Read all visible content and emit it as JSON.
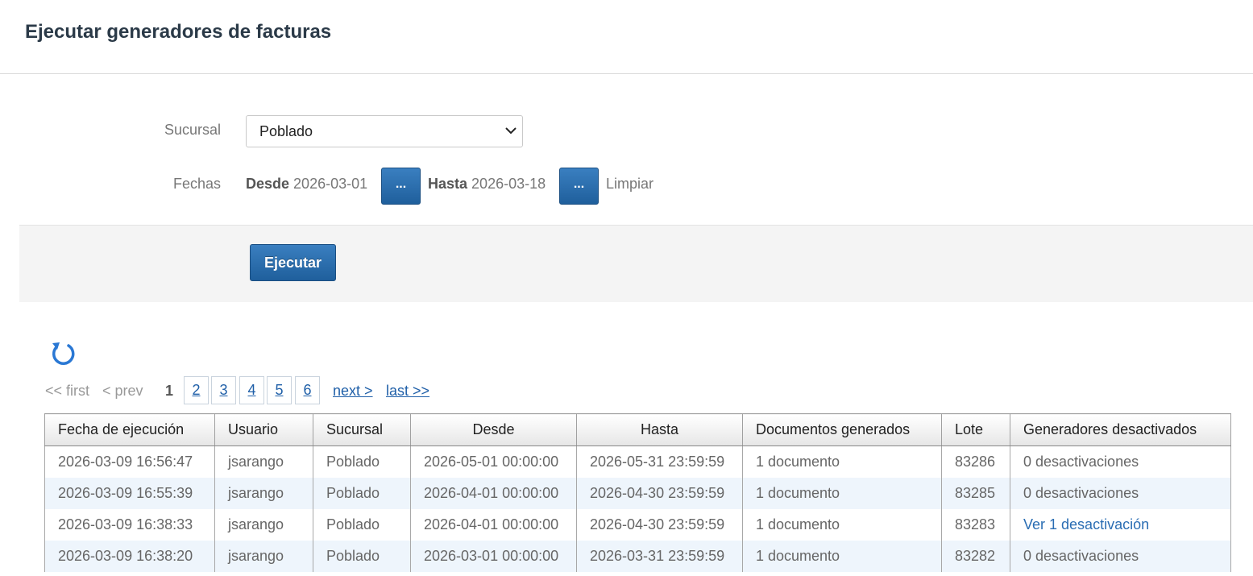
{
  "header": {
    "title": "Ejecutar generadores de facturas"
  },
  "form": {
    "sucursal_label": "Sucursal",
    "sucursal_value": "Poblado",
    "fechas_label": "Fechas",
    "desde_label": "Desde",
    "desde_value": "2026-03-01",
    "hasta_label": "Hasta",
    "hasta_value": "2026-03-18",
    "picker_label": "...",
    "limpiar_label": "Limpiar",
    "ejecutar_label": "Ejecutar"
  },
  "pager": {
    "first": "<< first",
    "prev": "< prev",
    "current": "1",
    "pages": [
      "2",
      "3",
      "4",
      "5",
      "6"
    ],
    "next": "next >",
    "last": "last >>"
  },
  "table": {
    "columns": [
      "Fecha de ejecución",
      "Usuario",
      "Sucursal",
      "Desde",
      "Hasta",
      "Documentos generados",
      "Lote",
      "Generadores desactivados"
    ],
    "rows": [
      [
        "2026-03-09 16:56:47",
        "jsarango",
        "Poblado",
        "2026-05-01 00:00:00",
        "2026-05-31 23:59:59",
        "1 documento",
        "83286",
        "0 desactivaciones"
      ],
      [
        "2026-03-09 16:55:39",
        "jsarango",
        "Poblado",
        "2026-04-01 00:00:00",
        "2026-04-30 23:59:59",
        "1 documento",
        "83285",
        "0 desactivaciones"
      ],
      [
        "2026-03-09 16:38:33",
        "jsarango",
        "Poblado",
        "2026-04-01 00:00:00",
        "2026-04-30 23:59:59",
        "1 documento",
        "83283",
        "Ver 1 desactivación"
      ],
      [
        "2026-03-09 16:38:20",
        "jsarango",
        "Poblado",
        "2026-03-01 00:00:00",
        "2026-03-31 23:59:59",
        "1 documento",
        "83282",
        "0 desactivaciones"
      ]
    ]
  },
  "colors": {
    "accent": "#2a6db3",
    "button": "#1f5f9c",
    "row_alt": "#eef5fc"
  },
  "icons": {
    "refresh": "refresh-icon",
    "dropdown": "chevron-down-icon"
  }
}
